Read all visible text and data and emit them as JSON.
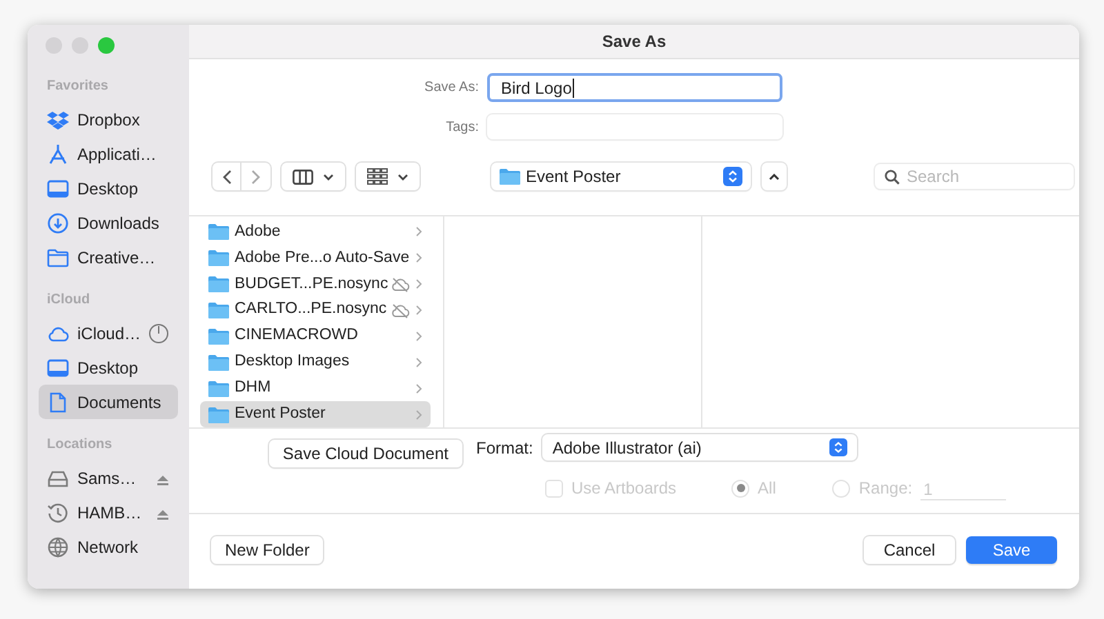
{
  "window": {
    "title": "Save As"
  },
  "sidebar": {
    "sections": [
      {
        "header": "Favorites",
        "items": [
          {
            "label": "Dropbox",
            "kind": "dropbox",
            "syncing": false,
            "ejectable": false,
            "selected": false
          },
          {
            "label": "Applicati…",
            "kind": "apps",
            "syncing": false,
            "ejectable": false,
            "selected": false
          },
          {
            "label": "Desktop",
            "kind": "desktop",
            "syncing": false,
            "ejectable": false,
            "selected": false
          },
          {
            "label": "Downloads",
            "kind": "downloads",
            "syncing": false,
            "ejectable": false,
            "selected": false
          },
          {
            "label": "Creative…",
            "kind": "folder",
            "syncing": false,
            "ejectable": false,
            "selected": false
          }
        ]
      },
      {
        "header": "iCloud",
        "items": [
          {
            "label": "iCloud…",
            "kind": "cloud",
            "syncing": true,
            "ejectable": false,
            "selected": false
          },
          {
            "label": "Desktop",
            "kind": "desktop",
            "syncing": false,
            "ejectable": false,
            "selected": false
          },
          {
            "label": "Documents",
            "kind": "document",
            "syncing": false,
            "ejectable": false,
            "selected": true
          }
        ]
      },
      {
        "header": "Locations",
        "items": [
          {
            "label": "Sams…",
            "kind": "drive",
            "syncing": false,
            "ejectable": true,
            "selected": false
          },
          {
            "label": "HAMB…",
            "kind": "clock",
            "syncing": false,
            "ejectable": true,
            "selected": false
          },
          {
            "label": "Network",
            "kind": "network",
            "syncing": false,
            "ejectable": false,
            "selected": false
          }
        ]
      }
    ]
  },
  "save_as": {
    "label": "Save As:",
    "value": "Bird Logo"
  },
  "tags": {
    "label": "Tags:"
  },
  "toolbar": {
    "location": "Event Poster",
    "search": {
      "placeholder": "Search"
    }
  },
  "browser": {
    "files": [
      {
        "name": "Adobe",
        "cloud_off": false,
        "selected": false
      },
      {
        "name": "Adobe Pre...o Auto-Save",
        "cloud_off": false,
        "selected": false
      },
      {
        "name": "BUDGET...PE.nosync",
        "cloud_off": true,
        "selected": false
      },
      {
        "name": "CARLTO...PE.nosync",
        "cloud_off": true,
        "selected": false
      },
      {
        "name": "CINEMACROWD",
        "cloud_off": false,
        "selected": false
      },
      {
        "name": "Desktop Images",
        "cloud_off": false,
        "selected": false
      },
      {
        "name": "DHM",
        "cloud_off": false,
        "selected": false
      },
      {
        "name": "Event Poster",
        "cloud_off": false,
        "selected": true
      }
    ]
  },
  "save_cloud_button": "Save Cloud Document",
  "format": {
    "label": "Format:",
    "value": "Adobe Illustrator (ai)"
  },
  "options": {
    "use_artboards": {
      "label": "Use Artboards",
      "checked": false,
      "disabled": true
    },
    "all": {
      "label": "All",
      "selected": true,
      "disabled": true
    },
    "range": {
      "label": "Range:",
      "selected": false,
      "disabled": true,
      "value": "1"
    }
  },
  "buttons": {
    "new_folder": "New Folder",
    "cancel": "Cancel",
    "save": "Save"
  }
}
